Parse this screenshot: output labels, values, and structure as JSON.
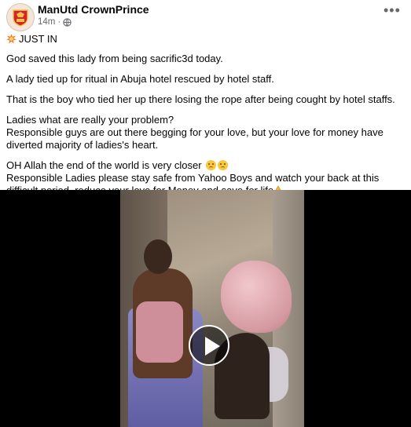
{
  "post": {
    "author": "ManUtd CrownPrince",
    "time": "14m",
    "separator": "·",
    "privacy_icon": "globe-icon",
    "more_icon": "more-options-icon",
    "lines": [
      "JUST IN",
      "God saved this lady from being sacrific3d today.",
      "A lady tied up for ritual in Abuja hotel rescued by hotel staff.",
      "That is the boy who tied her up there losing the rope after being cought by hotel staffs.",
      "Ladies what are really your problem?",
      " Responsible guys are out there begging for your love, but your love for money have diverted majority of ladies's heart.",
      " OH Allah the end of the world is very closer",
      "Responsible Ladies please stay safe from Yahoo Boys and watch your back at this difficult period, reduce your love for Money and save for life"
    ],
    "emoji": {
      "burst": "collision-emoji",
      "sad": "sad-face-emoji",
      "pray": "folded-hands-emoji"
    }
  },
  "media": {
    "type": "video",
    "play_icon": "play-icon"
  },
  "colors": {
    "text": "#050505",
    "meta": "#65676b",
    "media_bg": "#000000"
  }
}
